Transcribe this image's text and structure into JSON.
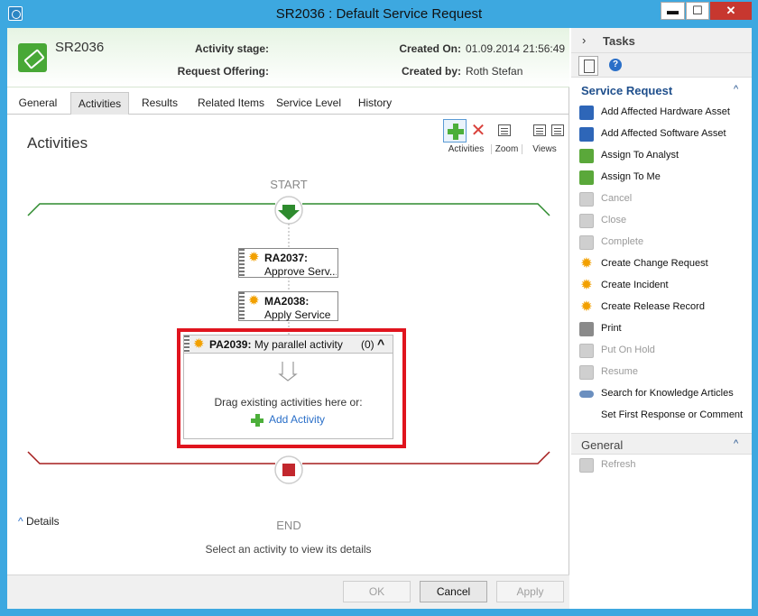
{
  "window": {
    "title": "SR2036 : Default Service Request",
    "min_label": "▬",
    "max_label": "☐",
    "close_label": "✕"
  },
  "header": {
    "id": "SR2036",
    "activity_stage_label": "Activity stage:",
    "request_offering_label": "Request Offering:",
    "created_on_label": "Created On:",
    "created_on_value": "01.09.2014 21:56:49",
    "created_by_label": "Created by:",
    "created_by_value": "Roth Stefan"
  },
  "tabs": [
    {
      "label": "General",
      "active": false
    },
    {
      "label": "Activities",
      "active": true
    },
    {
      "label": "Results",
      "active": false
    },
    {
      "label": "Related Items",
      "active": false
    },
    {
      "label": "Service Level",
      "active": false
    },
    {
      "label": "History",
      "active": false
    }
  ],
  "activities": {
    "title": "Activities",
    "toolbar": {
      "activities_label": "Activities",
      "zoom_label": "Zoom",
      "views_label": "Views"
    },
    "start_label": "START",
    "end_label": "END",
    "items": [
      {
        "id": "RA2037:",
        "title": "Approve Serv..."
      },
      {
        "id": "MA2038:",
        "title": "Apply Service"
      }
    ],
    "parallel": {
      "id": "PA2039:",
      "title": "My parallel activity",
      "count": "(0)",
      "drag_text": "Drag existing activities here or:",
      "add_label": "Add Activity"
    },
    "details_label": "Details",
    "details_empty": "Select an activity to view its details"
  },
  "footer": {
    "ok_label": "OK",
    "cancel_label": "Cancel",
    "apply_label": "Apply"
  },
  "tasks": {
    "header": "Tasks",
    "section_title": "Service Request",
    "items": [
      {
        "label": "Add Affected Hardware Asset",
        "icon": "hardware-icon",
        "enabled": true
      },
      {
        "label": "Add Affected Software Asset",
        "icon": "software-icon",
        "enabled": true
      },
      {
        "label": "Assign To Analyst",
        "icon": "assign-icon",
        "enabled": true
      },
      {
        "label": "Assign To Me",
        "icon": "assign-icon",
        "enabled": true
      },
      {
        "label": "Cancel",
        "icon": "cancel-icon",
        "enabled": false
      },
      {
        "label": "Close",
        "icon": "close-icon",
        "enabled": false
      },
      {
        "label": "Complete",
        "icon": "complete-icon",
        "enabled": false
      },
      {
        "label": "Create Change Request",
        "icon": "sun-icon",
        "enabled": true
      },
      {
        "label": "Create Incident",
        "icon": "sun-icon",
        "enabled": true
      },
      {
        "label": "Create Release Record",
        "icon": "sun-icon",
        "enabled": true
      },
      {
        "label": "Print",
        "icon": "print-icon",
        "enabled": true
      },
      {
        "label": "Put On Hold",
        "icon": "hold-icon",
        "enabled": false
      },
      {
        "label": "Resume",
        "icon": "resume-icon",
        "enabled": false
      },
      {
        "label": "Search for Knowledge Articles",
        "icon": "link-icon",
        "enabled": true
      },
      {
        "label": "Set First Response or Comment",
        "icon": "none",
        "enabled": true
      }
    ],
    "general_title": "General",
    "refresh_label": "Refresh"
  },
  "colors": {
    "window_frame": "#3da8e0",
    "start_line": "#2e8b2e",
    "end_line": "#a51d1d",
    "highlight": "#e0141e",
    "section_title": "#1f4f8c",
    "link": "#2a6fc8"
  }
}
